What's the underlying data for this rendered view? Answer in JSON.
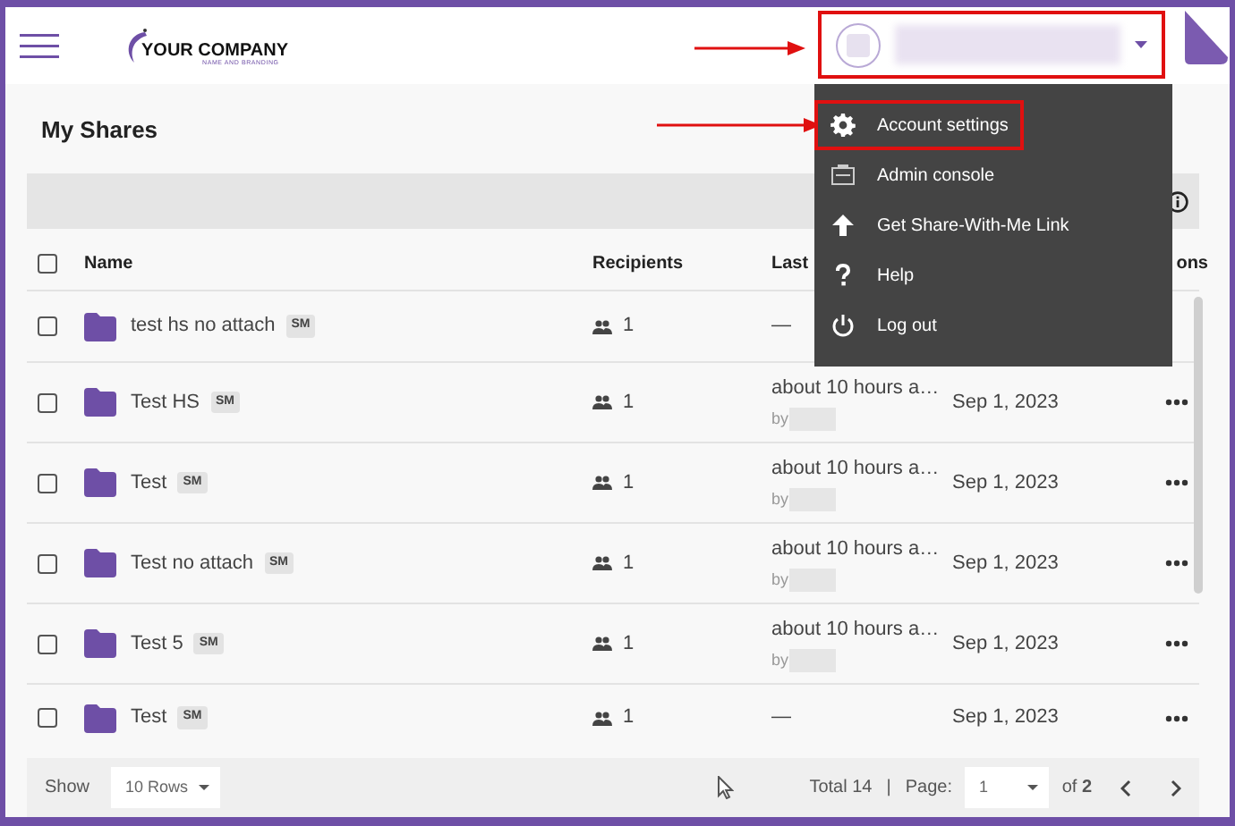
{
  "header": {
    "logo": {
      "name": "YOUR COMPANY",
      "tagline": "NAME AND BRANDING"
    },
    "user_chip": {
      "highlighted": true
    }
  },
  "user_menu": {
    "items": [
      {
        "label": "Account settings",
        "kind": "gear",
        "highlighted": true
      },
      {
        "label": "Admin console",
        "kind": "console",
        "highlighted": false
      },
      {
        "label": "Get Share-With-Me Link",
        "kind": "upload",
        "highlighted": false
      },
      {
        "label": "Help",
        "kind": "help",
        "highlighted": false
      },
      {
        "label": "Log out",
        "kind": "power",
        "highlighted": false
      }
    ]
  },
  "page_title": "My Shares",
  "table": {
    "select_all": {
      "checked": false
    },
    "columns": [
      "Name",
      "Recipients",
      "Last",
      "ons"
    ],
    "rows": [
      {
        "checked": false,
        "name": "test hs no attach",
        "tag": "SM",
        "recipients": "1",
        "last_access": "—",
        "more": false
      },
      {
        "checked": false,
        "name": "Test HS",
        "tag": "SM",
        "recipients": "1",
        "last_access": "about 10 hours a…",
        "by": "by",
        "date": "Sep 1, 2023",
        "more": true
      },
      {
        "checked": false,
        "name": "Test",
        "tag": "SM",
        "recipients": "1",
        "last_access": "about 10 hours a…",
        "by": "by",
        "date": "Sep 1, 2023",
        "more": true
      },
      {
        "checked": false,
        "name": "Test no attach",
        "tag": "SM",
        "recipients": "1",
        "last_access": "about 10 hours a…",
        "by": "by",
        "date": "Sep 1, 2023",
        "more": true
      },
      {
        "checked": false,
        "name": "Test 5",
        "tag": "SM",
        "recipients": "1",
        "last_access": "about 10 hours a…",
        "by": "by",
        "date": "Sep 1, 2023",
        "more": true
      },
      {
        "checked": false,
        "name": "Test",
        "tag": "SM",
        "recipients": "1",
        "last_access": "—",
        "date": "Sep 1, 2023",
        "more": true
      }
    ]
  },
  "footer": {
    "show_label": "Show",
    "rows_select": "10 Rows",
    "total": "Total 14",
    "separator": "|",
    "page_label": "Page:",
    "page_select": "1",
    "of_label": "of",
    "page_count": "2"
  }
}
